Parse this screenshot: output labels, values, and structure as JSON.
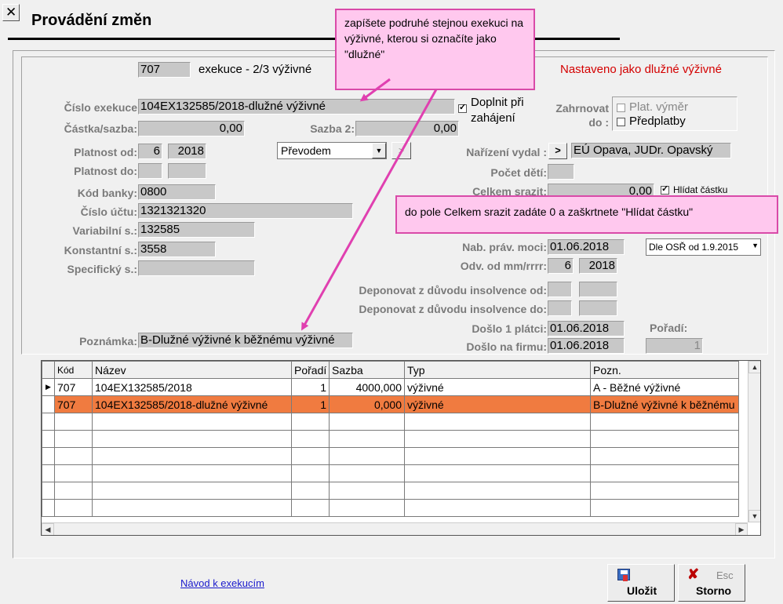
{
  "window": {
    "title": "Provádění změn",
    "close_glyph": "✕"
  },
  "header": {
    "code": "707",
    "exekuce_label": "exekuce - 2/3 výživné",
    "status_text": "Nastaveno jako dlužné výživné",
    "status_color": "#d40000"
  },
  "form": {
    "cislo_exekuce_label": "Číslo exekuce",
    "cislo_exekuce_value": "104EX132585/2018-dlužné výživné",
    "doplnit_label_1": "Doplnit při",
    "doplnit_label_2": "zahájení",
    "zahrnovat_label_1": "Zahrnovat",
    "zahrnovat_label_2": "do :",
    "plat_vymer_label": "Plat. výměr",
    "predplatby_label": "Předplatby",
    "castka_label": "Částka/sazba:",
    "castka_value": "0,00",
    "sazba2_label": "Sazba 2:",
    "sazba2_value": "0,00",
    "platnost_od_label": "Platnost od:",
    "platnost_od_month": "6",
    "platnost_od_year": "2018",
    "platnost_do_label": "Platnost do:",
    "platnost_do_month": "",
    "platnost_do_year": "",
    "prevodem_value": "Převodem",
    "narizeni_label": "Nařízení vydal :",
    "narizeni_btn": ">",
    "narizeni_value": "EÚ Opava, JUDr. Opavský",
    "pocet_deti_label": "Počet dětí:",
    "pocet_deti_value": "",
    "kod_banky_label": "Kód banky:",
    "kod_banky_value": "0800",
    "celkem_srazit_label": "Celkem srazit:",
    "celkem_srazit_value": "0,00",
    "hlidat_label": "Hlídat částku",
    "cislo_uctu_label": "Číslo účtu:",
    "cislo_uctu_value": "1321321320",
    "variabilni_label": "Variabilní s.:",
    "variabilni_value": "132585",
    "konstantni_label": "Konstantní s.:",
    "konstantni_value": "3558",
    "specificky_label": "Specifický s.:",
    "specificky_value": "",
    "nab_prav_label": "Nab. práv. moci:",
    "nab_prav_value": "01.06.2018",
    "osr_select_value": "Dle OSŘ od 1.9.2015",
    "odv_label": "Odv. od mm/rrrr:",
    "odv_month": "6",
    "odv_year": "2018",
    "dep_od_label": "Deponovat z důvodu insolvence od:",
    "dep_do_label": "Deponovat z důvodu insolvence do:",
    "doslo_platci_label": "Došlo 1 plátci:",
    "doslo_platci_value": "01.06.2018",
    "poradi_label": "Pořadí:",
    "poradi_value": "1",
    "doslo_firmu_label": "Došlo na firmu:",
    "doslo_firmu_value": "01.06.2018",
    "poznamka_label": "Poznámka:",
    "poznamka_value": "B-Dlužné výživné k běžnému výživné"
  },
  "callouts": {
    "top_text": "zapíšete podruhé stejnou exekuci na výživné, kterou si označíte jako \"dlužné\"",
    "mid_text": "do pole Celkem srazit zadáte 0 a zaškrtnete \"Hlídat částku\""
  },
  "grid": {
    "columns": [
      "Kód",
      "Název",
      "Pořadí",
      "Sazba",
      "Typ",
      "Pozn."
    ],
    "rows": [
      {
        "kod": "707",
        "nazev": "104EX132585/2018",
        "poradi": "1",
        "sazba": "4000,000",
        "typ": "výživné",
        "pozn": "A - Běžné výživné"
      },
      {
        "kod": "707",
        "nazev": "104EX132585/2018-dlužné výživné",
        "poradi": "1",
        "sazba": "0,000",
        "typ": "výživné",
        "pozn": "B-Dlužné výživné k běžnému"
      }
    ]
  },
  "footer": {
    "link_text": "Návod k exekucím",
    "save_label": "Uložit",
    "cancel_label": "Storno",
    "esc_label": "Esc"
  }
}
